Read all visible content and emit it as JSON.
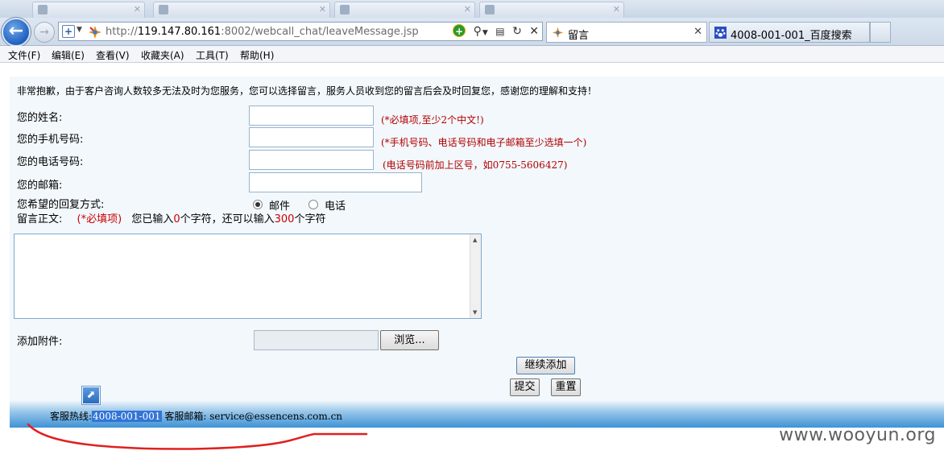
{
  "browser": {
    "url_host": "119.147.80.161",
    "url_prefix": "http://",
    "url_rest": ":8002/webcall_chat/leaveMessage.jsp",
    "tabs": [
      {
        "label": "留言",
        "active": true
      },
      {
        "label": "4008-001-001_百度搜索",
        "active": false
      }
    ],
    "menu": [
      "文件(F)",
      "编辑(E)",
      "查看(V)",
      "收藏夹(A)",
      "工具(T)",
      "帮助(H)"
    ],
    "icons": {
      "back": "back-arrow-icon",
      "forward": "forward-arrow-icon",
      "compat": "compat-view-icon",
      "search": "search-icon",
      "refresh": "refresh-icon",
      "stop": "close-icon"
    }
  },
  "form": {
    "notice": "非常抱歉，由于客户咨询人数较多无法及时为您服务，您可以选择留言，服务人员收到您的留言后会及时回复您，感谢您的理解和支持！",
    "name_label": "您的姓名:",
    "name_hint": "(*必填项,至少2个中文!)",
    "mobile_label": "您的手机号码:",
    "mobile_hint": "(*手机号码、电话号码和电子邮箱至少选填一个)",
    "phone_label": "您的电话号码:",
    "phone_hint": "(电话号码前加上区号，如0755-5606427)",
    "email_label": "您的邮箱:",
    "reply_label": "您希望的回复方式:",
    "reply_options": [
      {
        "label": "邮件",
        "selected": true
      },
      {
        "label": "电话",
        "selected": false
      }
    ],
    "body_label": "留言正文:",
    "body_required": "(*必填项)",
    "counter_prefix": "您已输入",
    "counter_typed": "0",
    "counter_mid": "个字符，还可以输入",
    "counter_remaining": "300",
    "counter_suffix": "个字符",
    "attach_label": "添加附件:",
    "browse_label": "浏览...",
    "add_more_label": "继续添加",
    "submit_label": "提交",
    "reset_label": "重置"
  },
  "footer": {
    "hotline_label": "客服热线:",
    "hotline_value": "4008-001-001",
    "email_label": "客服邮箱:",
    "email_value": "service@essencens.com.cn"
  },
  "watermark": "www.wooyun.org",
  "colors": {
    "hint_red": "#b30000",
    "counter_red": "#cc0000",
    "footer_blue": "#3e92d6",
    "content_bg": "#f2f8fc",
    "annotation_red": "#e02020"
  }
}
